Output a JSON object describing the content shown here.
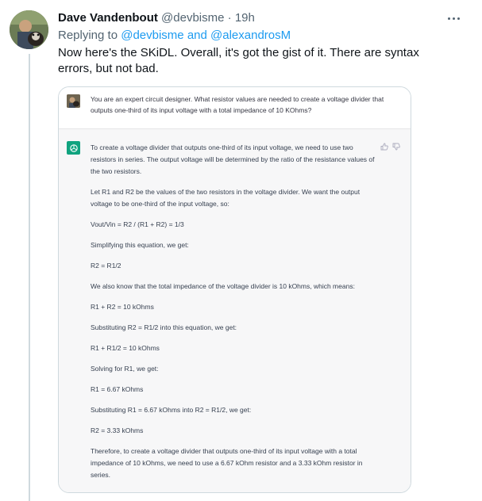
{
  "tweet": {
    "author_name": "Dave Vandenbout",
    "author_handle": "@devbisme",
    "separator": " · ",
    "time_ago": "19h",
    "replying_prefix": "Replying to ",
    "reply_target_1": "@devbisme",
    "reply_conjunction": " and ",
    "reply_target_2": "@alexandrosM",
    "text": "Now here's the SKiDL. Overall, it's got the gist of it. There are syntax errors, but not bad."
  },
  "chat": {
    "user_message": "You are an expert circuit designer. What resistor values are needed to create a voltage divider that outputs one-third of its input voltage with a total impedance of 10 KOhms?",
    "assistant_paragraphs": [
      "To create a voltage divider that outputs one-third of its input voltage, we need to use two resistors in series. The output voltage will be determined by the ratio of the resistance values of the two resistors.",
      "Let R1 and R2 be the values of the two resistors in the voltage divider. We want the output voltage to be one-third of the input voltage, so:",
      "Vout/Vin = R2 / (R1 + R2) = 1/3",
      "Simplifying this equation, we get:",
      "R2 = R1/2",
      "We also know that the total impedance of the voltage divider is 10 kOhms, which means:",
      "R1 + R2 = 10 kOhms",
      "Substituting R2 = R1/2 into this equation, we get:",
      "R1 + R1/2 = 10 kOhms",
      "Solving for R1, we get:",
      "R1 = 6.67 kOhms",
      "Substituting R1 = 6.67 kOhms into R2 = R1/2, we get:",
      "R2 = 3.33 kOhms",
      "Therefore, to create a voltage divider that outputs one-third of its input voltage with a total impedance of 10 kOhms, we need to use a 6.67 kOhm resistor and a 3.33 kOhm resistor in series."
    ]
  },
  "icons": {
    "more": "more-icon",
    "thumbs_up": "thumbs-up-icon",
    "thumbs_down": "thumbs-down-icon",
    "assistant_logo": "openai-logo-icon"
  },
  "colors": {
    "link": "#1d9bf0",
    "secondary_text": "#536471",
    "assistant_bg": "#f7f7f8",
    "assistant_icon_bg": "#10a37f"
  }
}
